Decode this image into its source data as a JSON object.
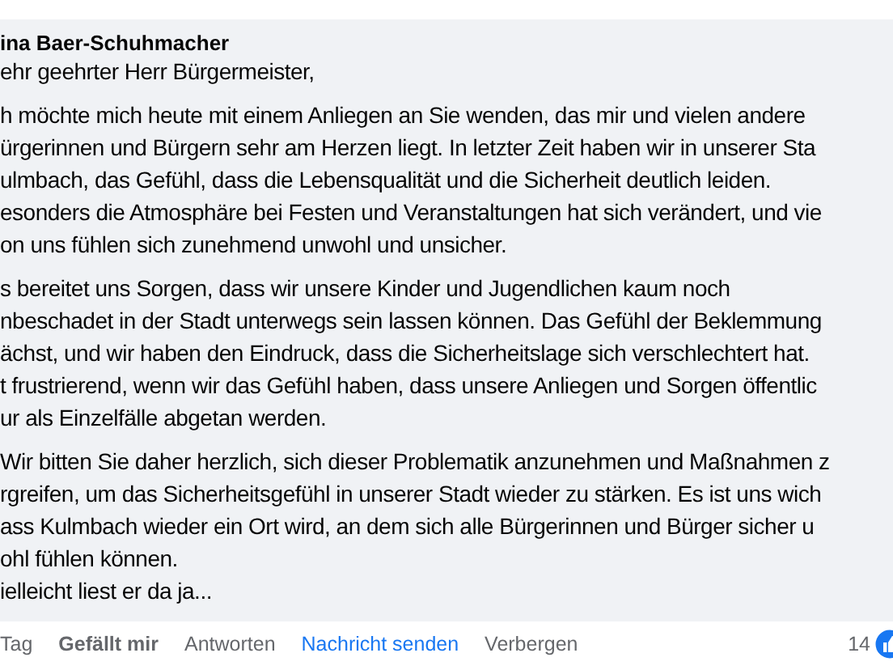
{
  "comment": {
    "author": "ina Baer-Schuhmacher",
    "paragraphs": [
      [
        "ehr geehrter Herr Bürgermeister,"
      ],
      [
        "h möchte mich heute mit einem Anliegen an Sie wenden, das mir und vielen andere",
        "ürgerinnen und Bürgern sehr am Herzen liegt. In letzter Zeit haben wir in unserer Sta",
        "ulmbach, das Gefühl, dass die Lebensqualität und die Sicherheit deutlich leiden.",
        "esonders die Atmosphäre bei Festen und Veranstaltungen hat sich verändert, und vie",
        "on uns fühlen sich zunehmend unwohl und unsicher."
      ],
      [
        "s bereitet uns Sorgen, dass wir unsere Kinder und Jugendlichen kaum noch",
        "nbeschadet in der Stadt unterwegs sein lassen können. Das Gefühl der Beklemmung",
        "ächst, und wir haben den Eindruck, dass die Sicherheitslage sich verschlechtert hat.",
        "t frustrierend, wenn wir das Gefühl haben, dass unsere Anliegen und Sorgen öffentlic",
        "ur als Einzelfälle abgetan werden."
      ],
      [
        "Wir bitten Sie daher herzlich, sich dieser Problematik anzunehmen und Maßnahmen z",
        "rgreifen, um das Sicherheitsgefühl in unserer Stadt wieder zu stärken. Es ist uns wich",
        "ass Kulmbach wieder ein Ort wird, an dem sich alle Bürgerinnen und Bürger sicher u",
        "ohl fühlen können.",
        "ielleicht liest er da ja..."
      ]
    ]
  },
  "actions": [
    {
      "label": "Tag",
      "kind": "time"
    },
    {
      "label": "Gefällt mir",
      "kind": "like"
    },
    {
      "label": "Antworten",
      "kind": "link"
    },
    {
      "label": "Nachricht senden",
      "kind": "message"
    },
    {
      "label": "Verbergen",
      "kind": "link"
    }
  ],
  "reaction_count": "14"
}
